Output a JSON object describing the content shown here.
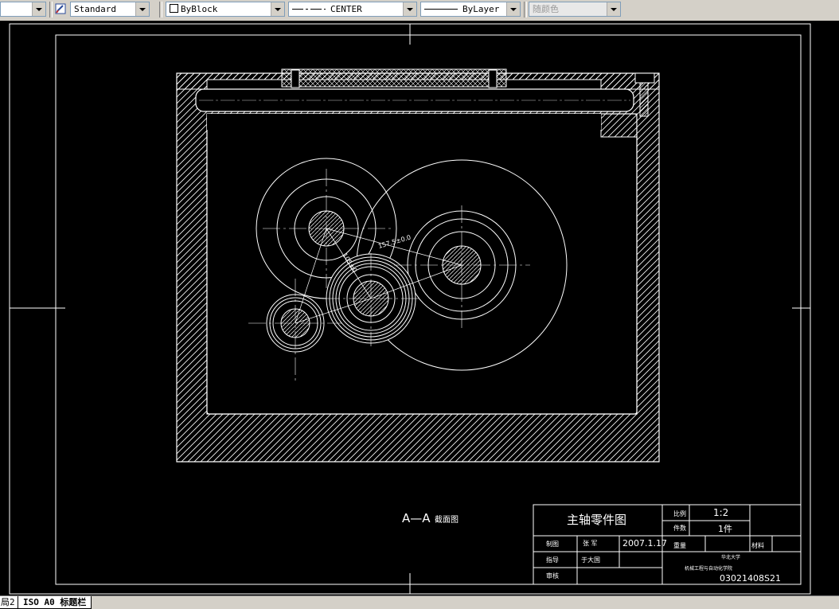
{
  "toolbar": {
    "text_style_value": "Standard",
    "color_value": "ByBlock",
    "linetype_value": "CENTER",
    "lineweight_value": "ByLayer",
    "plotstyle_value": "随颜色"
  },
  "drawing": {
    "section_label_main": "A—A",
    "section_label_sub": "截面图",
    "dimension_text_1": "157.5±0.0",
    "dimension_text_2": "105±0"
  },
  "title_block": {
    "part_name": "主轴零件图",
    "scale_label": "比例",
    "scale_value": "1:2",
    "quantity_label": "件数",
    "quantity_value": "1件",
    "drawn_label": "制图",
    "drawn_name": "张 军",
    "drawn_date": "2007.1.17",
    "weight_label": "重量",
    "material_label": "材料",
    "advisor_label": "指导",
    "advisor_name": "于大国",
    "review_label": "审核",
    "school": "华北大学",
    "department": "机械工程与自动化学院",
    "drawing_number": "03021408S21"
  },
  "status_tabs": {
    "tab_prev": "局2",
    "tab_current": "ISO A0 标题栏"
  }
}
